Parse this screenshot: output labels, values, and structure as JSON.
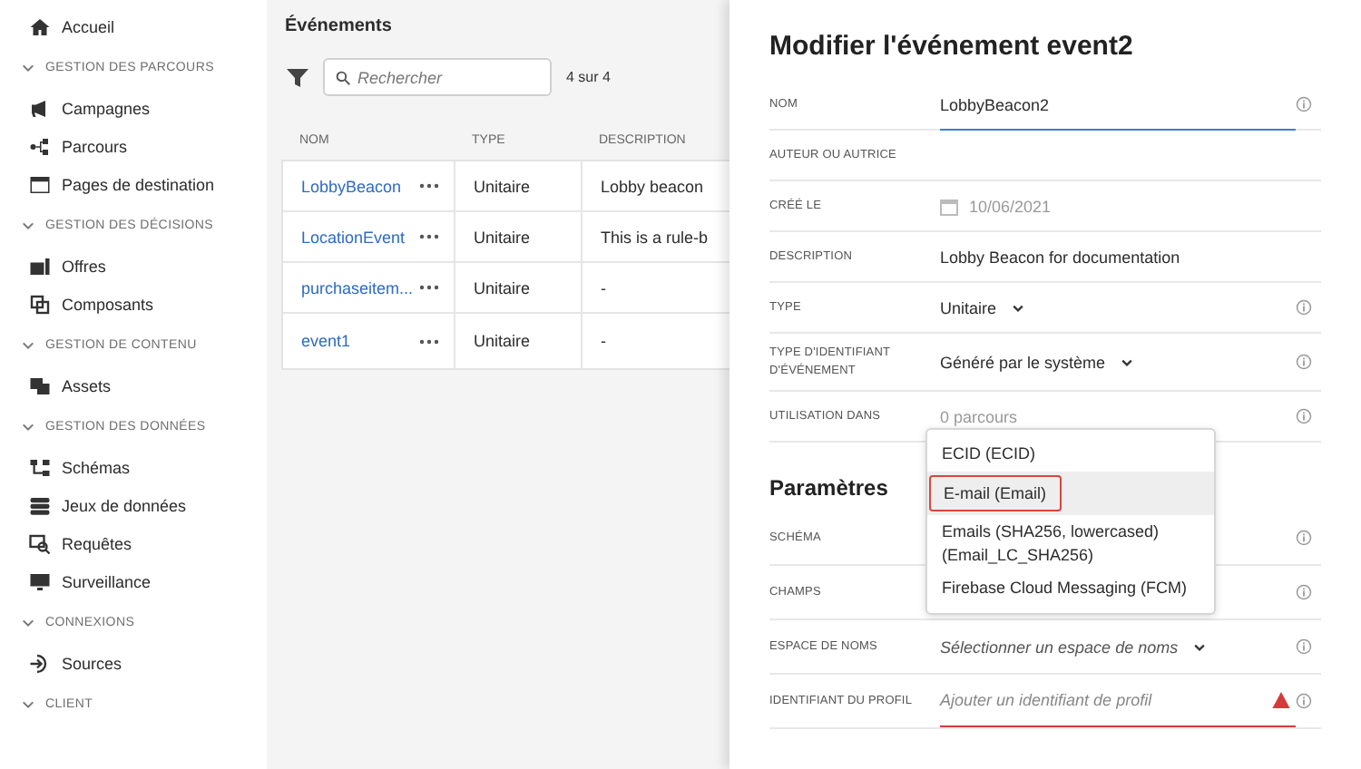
{
  "sidebar": {
    "home": "Accueil",
    "sections": [
      {
        "header": "GESTION DES PARCOURS",
        "expanded": true,
        "items": [
          "Campagnes",
          "Parcours",
          "Pages de destination"
        ]
      },
      {
        "header": "GESTION DES DÉCISIONS",
        "expanded": true,
        "items": [
          "Offres",
          "Composants"
        ]
      },
      {
        "header": "GESTION DE CONTENU",
        "expanded": true,
        "items": [
          "Assets"
        ]
      },
      {
        "header": "GESTION DES DONNÉES",
        "expanded": true,
        "items": [
          "Schémas",
          "Jeux de données",
          "Requêtes",
          "Surveillance"
        ]
      },
      {
        "header": "CONNEXIONS",
        "expanded": true,
        "items": [
          "Sources"
        ]
      },
      {
        "header": "CLIENT",
        "expanded": true
      }
    ]
  },
  "events": {
    "title": "Événements",
    "search": {
      "placeholder": "Rechercher"
    },
    "count": "4 sur 4",
    "table": {
      "columns": [
        "NOM",
        "TYPE",
        "DESCRIPTION"
      ],
      "rows": [
        {
          "name": "LobbyBeacon",
          "type": "Unitaire",
          "description": "Lobby beacon"
        },
        {
          "name": "LocationEvent",
          "type": "Unitaire",
          "description": "This is a rule-b"
        },
        {
          "name": "purchaseitem...",
          "type": "Unitaire",
          "description": "-"
        },
        {
          "name": "event1",
          "type": "Unitaire",
          "description": "-"
        }
      ]
    }
  },
  "editor": {
    "title": "Modifier l'événement event2",
    "fields": [
      {
        "label": "NOM",
        "kind": "input",
        "value": "LobbyBeacon2",
        "info": true
      },
      {
        "label": "AUTEUR OU AUTRICE",
        "kind": "text",
        "info": false
      },
      {
        "label": "CRÉÉ LE",
        "kind": "date",
        "value": "10/06/2021",
        "info": false
      },
      {
        "label": "DESCRIPTION",
        "kind": "text",
        "value": "Lobby Beacon for documentation",
        "info": false
      },
      {
        "label": "TYPE",
        "kind": "select",
        "value": "Unitaire",
        "info": true
      },
      {
        "label": "TYPE D'IDENTIFIANT D'ÉVÉNEMENT",
        "kind": "select",
        "value": "Généré par le système",
        "info": true
      },
      {
        "label": "UTILISATION DANS",
        "kind": "muted",
        "value": "0 parcours",
        "info": true
      }
    ],
    "section_title": "Paramètres",
    "parameters": [
      {
        "label": "SCHÉMA",
        "kind": "text",
        "info": true
      },
      {
        "label": "CHAMPS",
        "kind": "text",
        "info": true
      },
      {
        "label": "ESPACE DE NOMS",
        "kind": "placeholder-select",
        "placeholder": "Sélectionner un espace de noms",
        "info": true
      },
      {
        "label": "IDENTIFIANT DU PROFIL",
        "kind": "error-input",
        "placeholder": "Ajouter un identifiant de profil",
        "info": true
      }
    ],
    "menu": [
      {
        "label": "ECID (ECID)",
        "selected": false
      },
      {
        "label": "E-mail (Email)",
        "selected": true
      },
      {
        "label": "Emails (SHA256, lowercased) (Email_LC_SHA256)",
        "selected": false
      },
      {
        "label": "Firebase Cloud Messaging (FCM)",
        "selected": false
      }
    ]
  }
}
